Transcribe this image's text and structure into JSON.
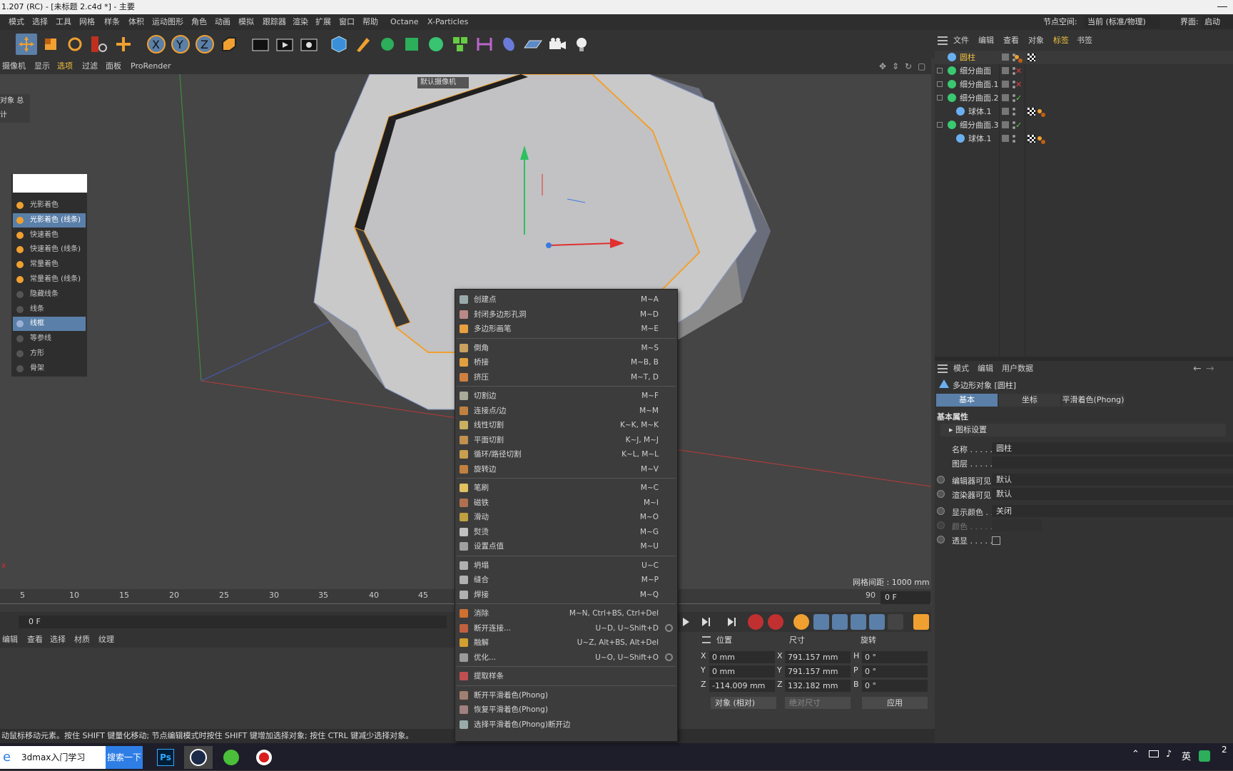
{
  "title": "1.207 (RC) - [未标题 2.c4d *] - 主要",
  "menubar": {
    "items": [
      "模式",
      "选择",
      "工具",
      "网格",
      "样条",
      "体积",
      "运动图形",
      "角色",
      "动画",
      "模拟",
      "跟踪器",
      "渲染",
      "扩展",
      "窗口",
      "帮助",
      "Octane",
      "X-Particles"
    ],
    "node_space_label": "节点空间:",
    "node_space_value": "当前 (标准/物理)",
    "layout_label": "界面:",
    "layout_value": "启动"
  },
  "vpmenu": {
    "items": [
      "摄像机",
      "显示",
      "选项",
      "过滤",
      "面板",
      "ProRender"
    ]
  },
  "viewport": {
    "camera_label": "默认摄像机",
    "grid_note": "网格间距 : 1000 mm",
    "obj_tab": "对象",
    "obj_tab2": "总计",
    "axis_label": "x"
  },
  "shading": {
    "items": [
      "光影着色",
      "光影着色 (线条)",
      "快速着色",
      "快速着色 (线条)",
      "常量着色",
      "常量着色 (线条)",
      "隐藏线条",
      "线条",
      "线框",
      "等参线",
      "方形",
      "骨架"
    ],
    "selected": [
      "光影着色 (线条)",
      "线框"
    ]
  },
  "timeline": {
    "ticks": [
      "5",
      "10",
      "15",
      "20",
      "25",
      "30",
      "35",
      "40",
      "45",
      "90"
    ],
    "frame_right": "0 F",
    "frame_current": "0 F"
  },
  "matmenu": {
    "items": [
      "编辑",
      "查看",
      "选择",
      "材质",
      "纹理"
    ]
  },
  "coords": {
    "headers": [
      "位置",
      "尺寸",
      "旋转"
    ],
    "rows": [
      {
        "axis": "X",
        "pos": "0 mm",
        "saxis": "X",
        "size": "791.157 mm",
        "raxis": "H",
        "rot": "0 °"
      },
      {
        "axis": "Y",
        "pos": "0 mm",
        "saxis": "Y",
        "size": "791.157 mm",
        "raxis": "P",
        "rot": "0 °"
      },
      {
        "axis": "Z",
        "pos": "-114.009 mm",
        "saxis": "Z",
        "size": "132.182 mm",
        "raxis": "B",
        "rot": "0 °"
      }
    ],
    "mode": "对象 (相对)",
    "size_mode": "绝对尺寸",
    "apply": "应用"
  },
  "status": "动鼠标移动元素。按住 SHIFT 键量化移动; 节点编辑模式时按住 SHIFT 键增加选择对象; 按住 CTRL 键减少选择对象。",
  "taskbar": {
    "search": "3dmax入门学习",
    "search_btn": "搜索一下",
    "ps": "Ps",
    "ime": "英",
    "clock": "2"
  },
  "objects": {
    "menu": [
      "文件",
      "编辑",
      "查看",
      "对象",
      "标签",
      "书签"
    ],
    "rows": [
      {
        "name": "圆柱",
        "indent": 0,
        "color": "#f0c040",
        "highlight": true
      },
      {
        "name": "细分曲面",
        "indent": 0,
        "color": "#d8d8d8"
      },
      {
        "name": "细分曲面.1",
        "indent": 0,
        "color": "#d8d8d8"
      },
      {
        "name": "细分曲面.2",
        "indent": 0,
        "color": "#d8d8d8"
      },
      {
        "name": "球体.1",
        "indent": 1,
        "color": "#d8d8d8"
      },
      {
        "name": "细分曲面.3",
        "indent": 0,
        "color": "#d8d8d8"
      },
      {
        "name": "球体.1",
        "indent": 1,
        "color": "#d8d8d8"
      }
    ]
  },
  "attributes": {
    "menu": [
      "模式",
      "编辑",
      "用户数据"
    ],
    "title": "多边形对象 [圆柱]",
    "tabs": [
      "基本",
      "坐标",
      "平滑着色(Phong)"
    ],
    "section": "基本属性",
    "subsection": "图标设置",
    "fields": [
      {
        "label": "名称 . . . . .",
        "value": "圆柱"
      },
      {
        "label": "图层 . . . . .",
        "value": ""
      },
      {
        "label": "编辑器可见",
        "value": "默认"
      },
      {
        "label": "渲染器可见",
        "value": "默认"
      },
      {
        "label": "显示颜色 . .",
        "value": "关闭"
      },
      {
        "label": "颜色 . . . . .",
        "value": ""
      },
      {
        "label": "透显 . . . . .",
        "value": ""
      }
    ]
  },
  "context_menu": {
    "groups": [
      [
        {
          "label": "创建点",
          "sc": "M~A"
        },
        {
          "label": "封闭多边形孔洞",
          "sc": "M~D"
        },
        {
          "label": "多边形画笔",
          "sc": "M~E"
        }
      ],
      [
        {
          "label": "倒角",
          "sc": "M~S"
        },
        {
          "label": "桥接",
          "sc": "M~B, B"
        },
        {
          "label": "挤压",
          "sc": "M~T, D"
        }
      ],
      [
        {
          "label": "切割边",
          "sc": "M~F"
        },
        {
          "label": "连接点/边",
          "sc": "M~M"
        },
        {
          "label": "线性切割",
          "sc": "K~K, M~K"
        },
        {
          "label": "平面切割",
          "sc": "K~J, M~J"
        },
        {
          "label": "循环/路径切割",
          "sc": "K~L, M~L"
        },
        {
          "label": "旋转边",
          "sc": "M~V"
        }
      ],
      [
        {
          "label": "笔刷",
          "sc": "M~C"
        },
        {
          "label": "磁铁",
          "sc": "M~I"
        },
        {
          "label": "滑动",
          "sc": "M~O"
        },
        {
          "label": "熨烫",
          "sc": "M~G"
        },
        {
          "label": "设置点值",
          "sc": "M~U"
        }
      ],
      [
        {
          "label": "坍塌",
          "sc": "U~C"
        },
        {
          "label": "缝合",
          "sc": "M~P"
        },
        {
          "label": "焊接",
          "sc": "M~Q"
        }
      ],
      [
        {
          "label": "消除",
          "sc": "M~N, Ctrl+BS, Ctrl+Del"
        },
        {
          "label": "断开连接...",
          "sc": "U~D, U~Shift+D",
          "gear": true
        },
        {
          "label": "融解",
          "sc": "U~Z, Alt+BS, Alt+Del"
        },
        {
          "label": "优化...",
          "sc": "U~O, U~Shift+O",
          "gear": true
        }
      ],
      [
        {
          "label": "提取样条",
          "sc": ""
        }
      ],
      [
        {
          "label": "断开平滑着色(Phong)",
          "sc": ""
        },
        {
          "label": "恢复平滑着色(Phong)",
          "sc": ""
        },
        {
          "label": "选择平滑着色(Phong)断开边",
          "sc": ""
        }
      ]
    ]
  },
  "colors": {
    "accent": "#5a7fa8",
    "orange": "#f0a030",
    "panel": "#333333"
  }
}
